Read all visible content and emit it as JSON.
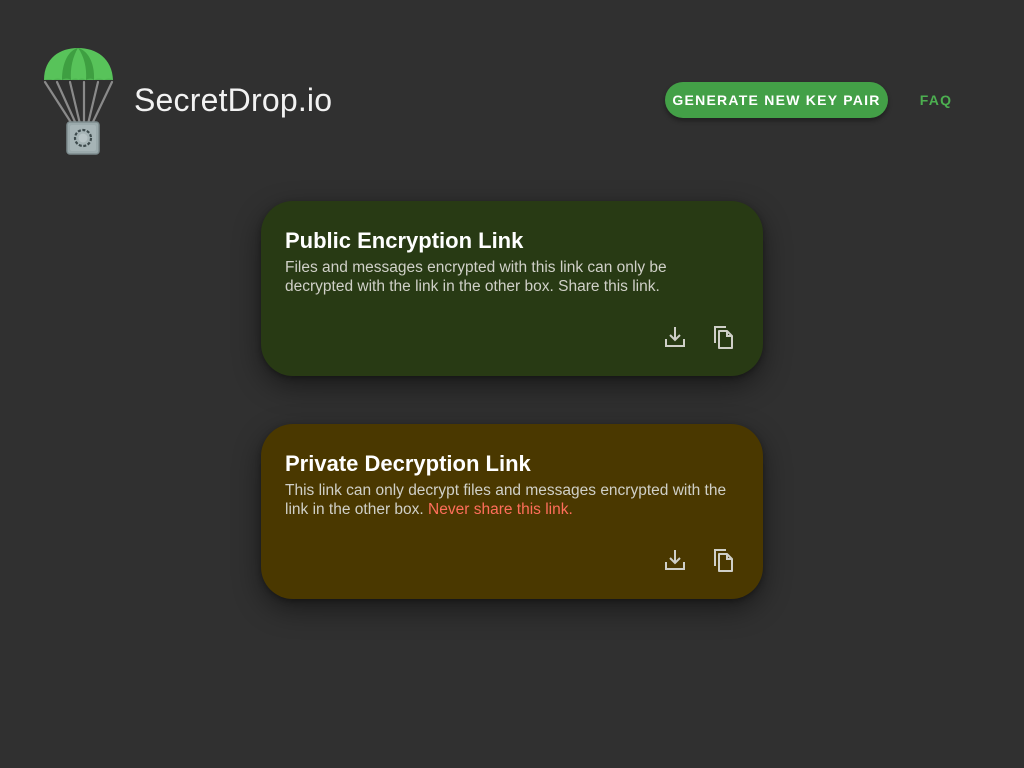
{
  "header": {
    "brand": "SecretDrop.io",
    "logo_icon": "parachute-safe-icon",
    "generate_label": "GENERATE NEW KEY PAIR",
    "faq_label": "FAQ"
  },
  "cards": {
    "public": {
      "title": "Public Encryption Link",
      "description": "Files and messages encrypted with this link can only be decrypted with the link in the other box. Share this link.",
      "download_icon": "download-icon",
      "copy_icon": "copy-icon"
    },
    "private": {
      "title": "Private Decryption Link",
      "description": "This link can only decrypt files and messages encrypted with the link in the other box.",
      "warning": "Never share this link.",
      "download_icon": "download-icon",
      "copy_icon": "copy-icon"
    }
  },
  "colors": {
    "background": "#303030",
    "accent_green": "#43a047",
    "public_card": "#283a14",
    "private_card": "#4a3800",
    "warning_text": "#ff6e5a"
  }
}
